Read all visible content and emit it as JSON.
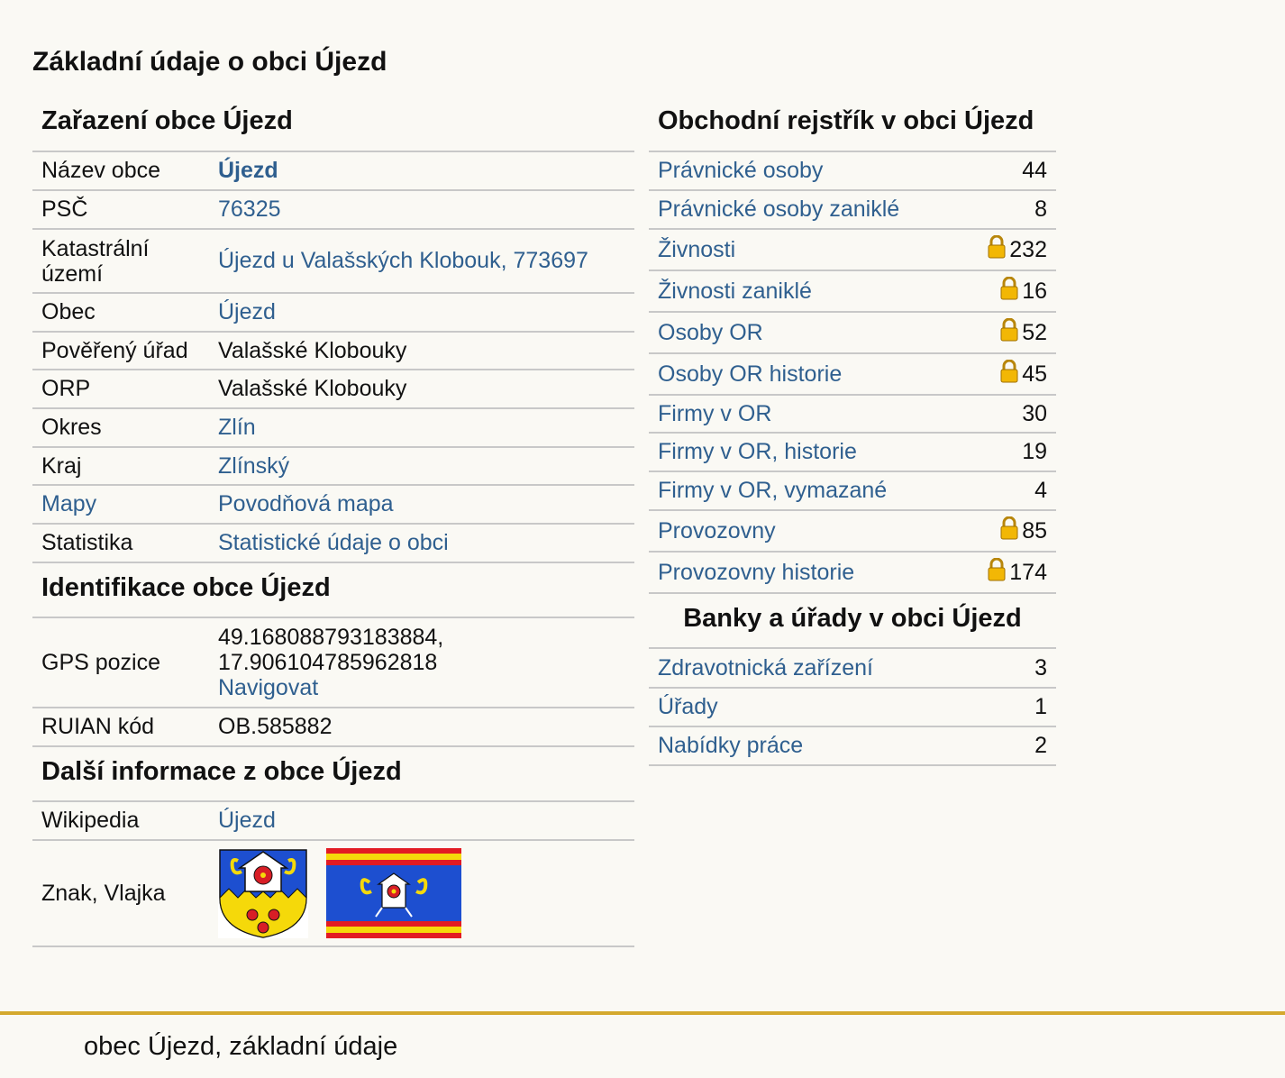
{
  "page_title": "Základní údaje o obci Újezd",
  "zarazeni": {
    "title": "Zařazení obce Újezd",
    "rows": [
      {
        "label": "Název obce",
        "value": "Újezd"
      },
      {
        "label": "PSČ",
        "value": "76325"
      },
      {
        "label": "Katastrální území",
        "value": "Újezd u Valašských Klobouk, 773697"
      },
      {
        "label": "Obec",
        "value": "Újezd"
      },
      {
        "label": "Pověřený úřad",
        "value": "Valašské Klobouky"
      },
      {
        "label": "ORP",
        "value": "Valašské Klobouky"
      },
      {
        "label": "Okres",
        "value": "Zlín"
      },
      {
        "label": "Kraj",
        "value": "Zlínský"
      },
      {
        "label": "Mapy",
        "value": "Povodňová mapa"
      },
      {
        "label": "Statistika",
        "value": "Statistické údaje o obci"
      }
    ]
  },
  "identifikace": {
    "title": "Identifikace obce Újezd",
    "gps_label": "GPS pozice",
    "gps_lat": "49.168088793183884,",
    "gps_lon": "17.906104785962818",
    "navigate": "Navigovat",
    "ruian_label": "RUIAN kód",
    "ruian_value": "OB.585882"
  },
  "dalsi": {
    "title": "Další informace z obce Újezd",
    "wiki_label": "Wikipedia",
    "wiki_value": "Újezd",
    "znak_label": "Znak, Vlajka"
  },
  "obchodni": {
    "title": "Obchodní rejstřík v obci Újezd",
    "rows": [
      {
        "label": "Právnické osoby",
        "value": "44",
        "locked": false
      },
      {
        "label": "Právnické osoby zaniklé",
        "value": "8",
        "locked": false
      },
      {
        "label": "Živnosti",
        "value": "232",
        "locked": true
      },
      {
        "label": "Živnosti zaniklé",
        "value": "16",
        "locked": true
      },
      {
        "label": "Osoby OR",
        "value": "52",
        "locked": true
      },
      {
        "label": "Osoby OR historie",
        "value": "45",
        "locked": true
      },
      {
        "label": "Firmy v OR",
        "value": "30",
        "locked": false
      },
      {
        "label": "Firmy v OR, historie",
        "value": "19",
        "locked": false
      },
      {
        "label": "Firmy v OR, vymazané",
        "value": "4",
        "locked": false
      },
      {
        "label": "Provozovny",
        "value": "85",
        "locked": true
      },
      {
        "label": "Provozovny historie",
        "value": "174",
        "locked": true
      }
    ]
  },
  "banky": {
    "title": "Banky a úřady v obci Újezd",
    "rows": [
      {
        "label": "Zdravotnická zařízení",
        "value": "3"
      },
      {
        "label": "Úřady",
        "value": "1"
      },
      {
        "label": "Nabídky práce",
        "value": "2"
      }
    ]
  },
  "footer": "obec Újezd, základní údaje",
  "colors": {
    "link": "#2f5f8f",
    "footer_line": "#d4a92e",
    "background": "#faf9f4"
  }
}
